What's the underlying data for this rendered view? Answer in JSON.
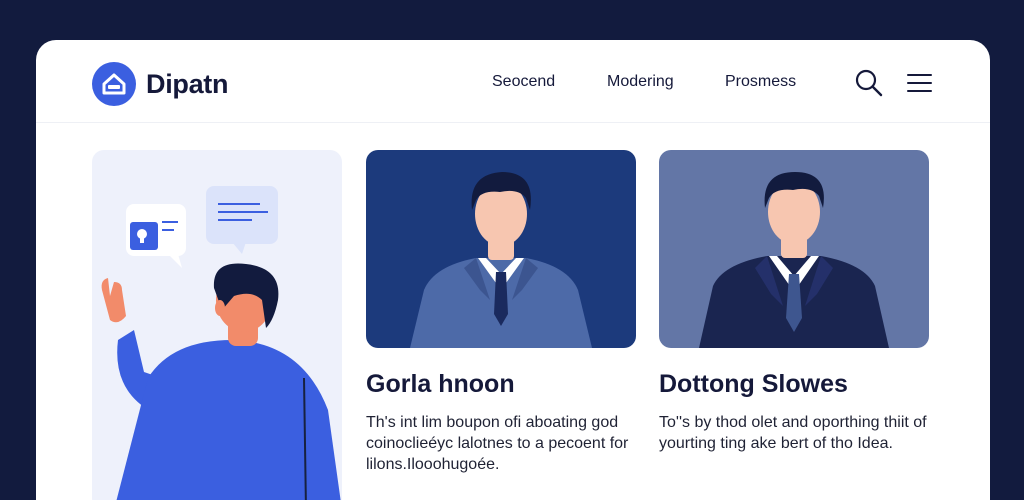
{
  "header": {
    "brand": "Dipatn",
    "nav": [
      "Seocend",
      "Modering",
      "Prosmess"
    ]
  },
  "icons": {
    "logo": "home-icon",
    "search": "search-icon",
    "menu": "hamburger-menu-icon"
  },
  "cards": [
    {
      "title": "Gorla hnoon",
      "text": "Th's int lim boupon ofi aboating god coinoclieéyc lalotnes to a pecoent for lilons.Ilooohugoée."
    },
    {
      "title": "Dottong Slowes",
      "text": "To''s by thod olet and oporthing thiit of yourting ting ake bert of tho Idea."
    }
  ],
  "colors": {
    "background": "#121b3e",
    "accent": "#3b5fe0",
    "card_1_bg": "#1c3a7c",
    "card_2_bg": "#6376a6",
    "illustration_bg": "#eef1fb"
  }
}
